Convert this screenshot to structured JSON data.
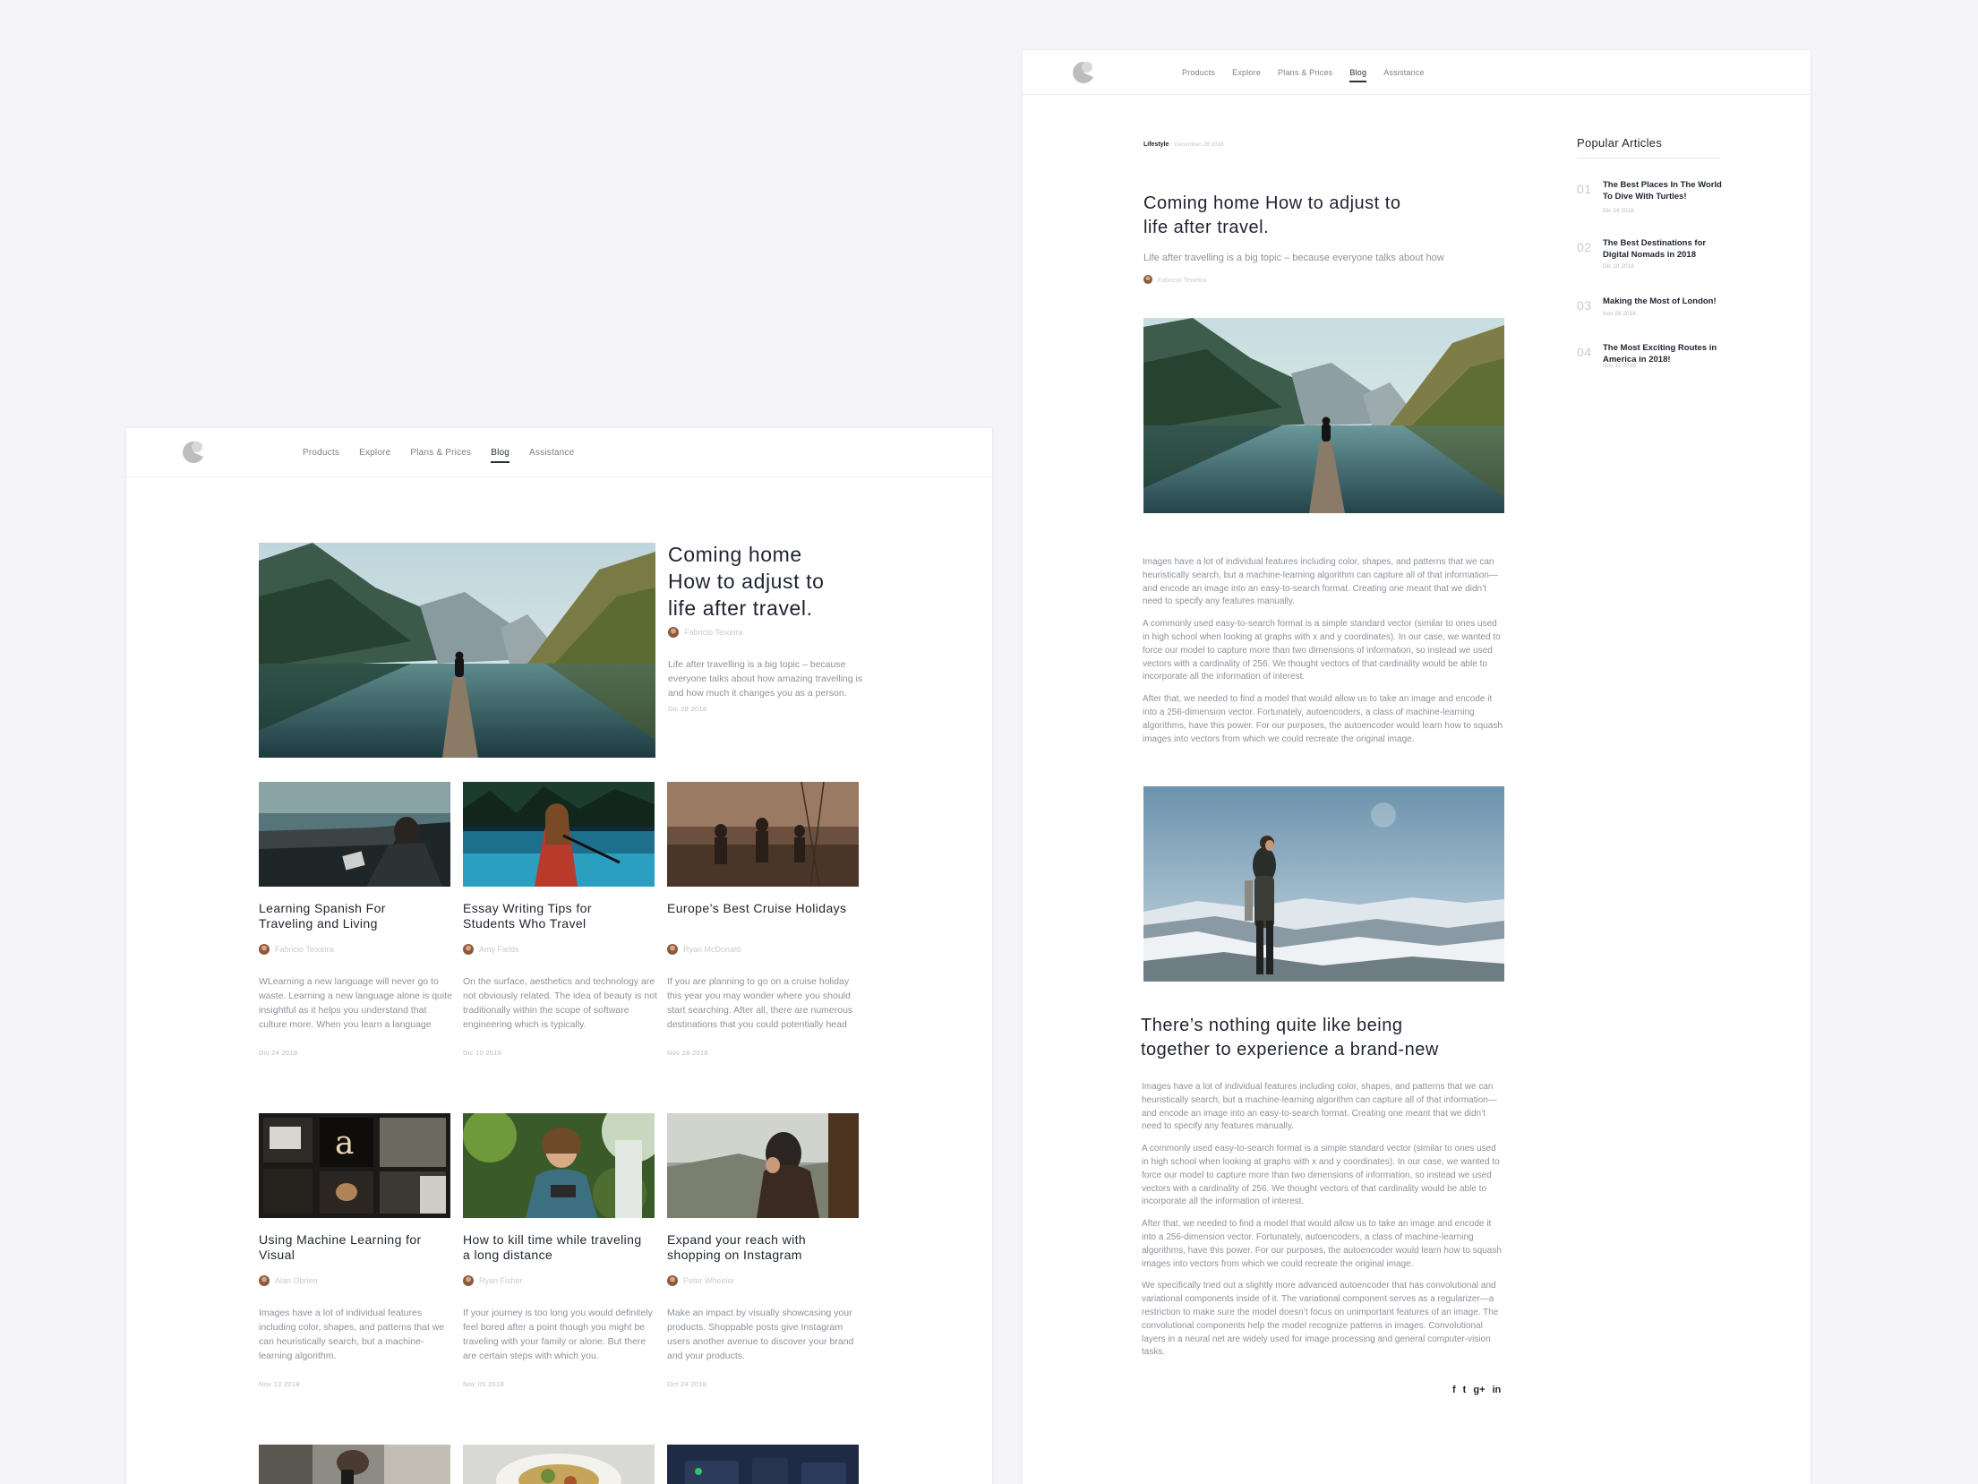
{
  "nav": {
    "items": [
      "Products",
      "Explore",
      "Plans & Prices",
      "Blog",
      "Assistance"
    ],
    "active": "Blog"
  },
  "blog_list": {
    "featured": {
      "title_lines": [
        "Coming home",
        "How to adjust to",
        "life after travel."
      ],
      "author": "Fabricio Teixeira",
      "excerpt": "Life after travelling is a big topic – because everyone talks about how amazing travelling is and how much it changes you as a person.",
      "date": "Dic 28 2018"
    },
    "cards": [
      {
        "title": "Learning Spanish For Traveling and Living",
        "author": "Fabricio Teixeira",
        "excerpt": "WLearning a new language will never go to waste. Learning a new language alone is quite insightful as it helps you understand that culture more. When you learn a language",
        "date": "Dic 24 2018"
      },
      {
        "title": "Essay Writing Tips for Students Who Travel",
        "author": "Amy Fields",
        "excerpt": "On the surface, aesthetics and technology are not obviously related. The idea of beauty is not traditionally within the scope of software engineering which is typically.",
        "date": "Dic 10 2018"
      },
      {
        "title": "Europe’s Best Cruise Holidays",
        "author": "Ryan McDonald",
        "excerpt": "If you are planning to go on a cruise holiday this year you may wonder where you should start searching. After all, there are numerous destinations that you could potentially head",
        "date": "Nov 28 2018"
      },
      {
        "title": "Using Machine Learning for Visual",
        "author": "Alan Obrien",
        "excerpt": "Images have a lot of individual features including color, shapes, and patterns that we can heuristically search, but a machine-learning algorithm.",
        "date": "Nov 12 2018"
      },
      {
        "title": "How to kill time while traveling a long distance",
        "author": "Ryan Fisher",
        "excerpt": "If your journey is too long you would definitely feel bored after a point though you might be traveling with your family or alone. But there are certain steps with which you.",
        "date": "Nov 05 2018"
      },
      {
        "title": "Expand your reach with shopping on Instagram",
        "author": "Peter Wheeler",
        "excerpt": "Make an impact by visually showcasing your products. Shoppable posts give Instagram users another avenue to discover your brand and your products.",
        "date": "Oct 24 2018"
      }
    ]
  },
  "article": {
    "category": "Lifestyle",
    "date": "December 28 2018",
    "title_lines": [
      "Coming home  How to adjust to",
      "life after travel."
    ],
    "subtitle": "Life after travelling is a big topic – because everyone talks about how",
    "author": "Fabricio Teixeira",
    "paragraphs_1": [
      "Images have a lot of individual features including color, shapes, and patterns that we can heuristically search, but a machine-learning algorithm can capture all of that information—and encode an image into an easy-to-search format. Creating one meant that we didn’t need to specify any features manually.",
      "A commonly used easy-to-search format is a simple standard vector (similar to ones used in high school when looking at graphs with x and y coordinates). In our case, we wanted to force our model to capture more than two dimensions of information, so instead we used vectors with a cardinality of 256. We thought vectors of that cardinality would be able to incorporate all the information of interest.",
      "After that, we needed to find a model that would allow us to take an image and encode it into a 256-dimension vector. Fortunately, autoencoders, a class of machine-learning algorithms, have this power. For our purposes, the autoencoder would learn how to squash images into vectors from which we could recreate the original image."
    ],
    "subheading_lines": [
      "There’s nothing quite like being",
      "together to experience a brand-new"
    ],
    "paragraphs_2": [
      "Images have a lot of individual features including color, shapes, and patterns that we can heuristically search, but a machine-learning algorithm can capture all of that information—and encode an image into an easy-to-search format. Creating one meant that we didn’t need to specify any features manually.",
      "A commonly used easy-to-search format is a simple standard vector (similar to ones used in high school when looking at graphs with x and y coordinates). In our case, we wanted to force our model to capture more than two dimensions of information, so instead we used vectors with a cardinality of 256. We thought vectors of that cardinality would be able to incorporate all the information of interest.",
      "After that, we needed to find a model that would allow us to take an image and encode it into a 256-dimension vector. Fortunately, autoencoders, a class of machine-learning algorithms, have this power. For our purposes, the autoencoder would learn how to squash images into vectors from which we could recreate the original image.",
      "We specifically tried out a slightly more advanced autoencoder that has convolutional and variational components inside of it. The variational component serves as a regularizer—a restriction to make sure the model doesn’t focus on unimportant features of an image. The convolutional components help the model recognize patterns in images. Convolutional layers in a neural net are widely used for image processing and general computer-vision tasks."
    ],
    "share": [
      "f",
      "t",
      "g+",
      "in"
    ]
  },
  "popular": {
    "heading": "Popular Articles",
    "items": [
      {
        "num": "01",
        "title": "The Best Places In The World To Dive With Turtles!",
        "date": "Dic 24 2018"
      },
      {
        "num": "02",
        "title": "The Best Destinations for Digital Nomads in 2018",
        "date": "Dic 10 2018"
      },
      {
        "num": "03",
        "title": "Making the Most of London!",
        "date": "Nov 28 2018"
      },
      {
        "num": "04",
        "title": "The Most Exciting Routes in America in 2018!",
        "date": "Nov 12 2018"
      }
    ]
  }
}
